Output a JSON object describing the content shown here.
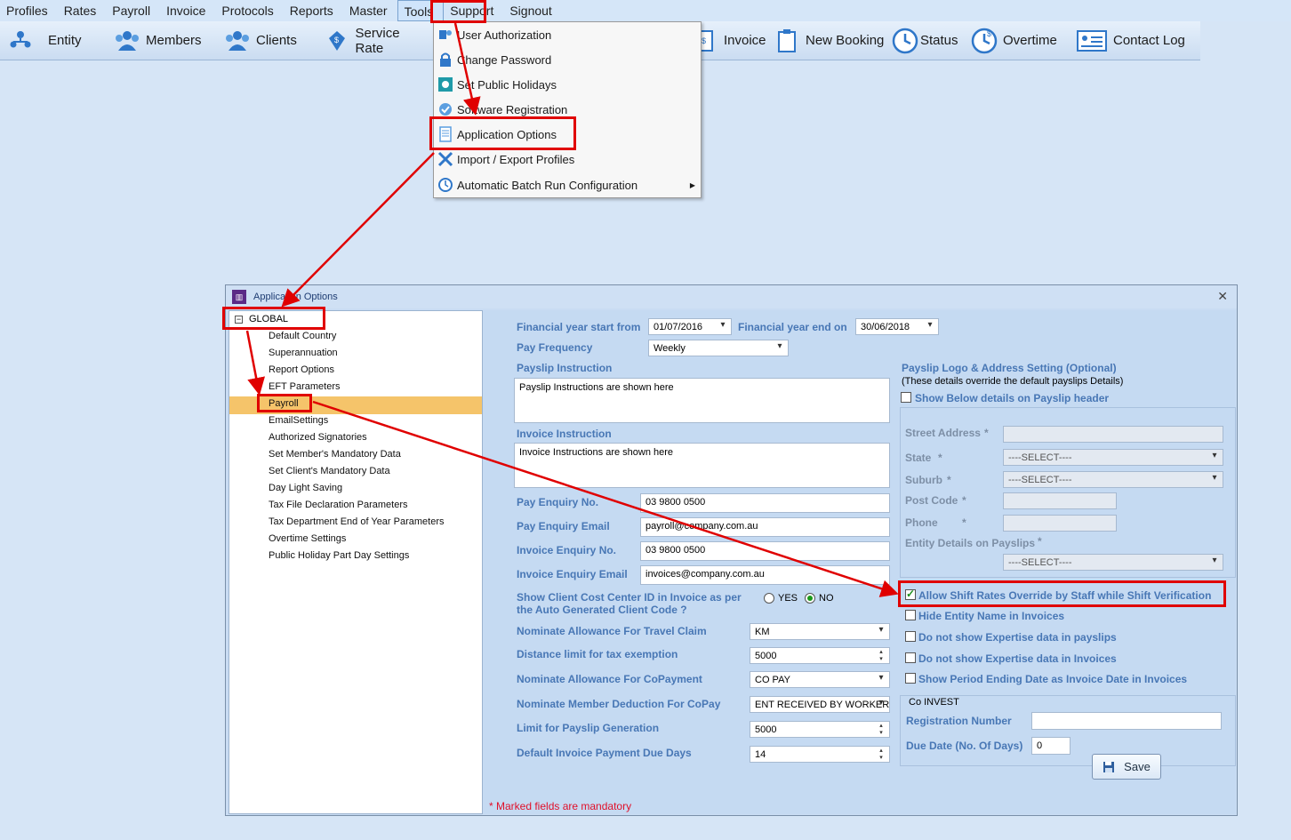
{
  "menubar": {
    "items": [
      "Profiles",
      "Rates",
      "Payroll",
      "Invoice",
      "Protocols",
      "Reports",
      "Master",
      "Tools",
      "Support",
      "Signout"
    ]
  },
  "toolbar": {
    "entity": "Entity",
    "members": "Members",
    "clients": "Clients",
    "service_rates": "Service Rate",
    "invoice": "Invoice",
    "new_booking": "New Booking",
    "status": "Status",
    "overtime": "Overtime",
    "contact_log": "Contact Log"
  },
  "tools_menu": {
    "items": [
      "User Authorization",
      "Change Password",
      "Set Public Holidays",
      "Software Registration",
      "Application Options",
      "Import / Export Profiles",
      "Automatic Batch Run Configuration"
    ]
  },
  "dialog": {
    "title": "Application Options",
    "close": "✕",
    "tree": {
      "root": "GLOBAL",
      "toggle": "−",
      "items": [
        "Default Country",
        "Superannuation",
        "Report Options",
        "EFT Parameters",
        "Payroll",
        "EmailSettings",
        "Authorized Signatories",
        "Set Member's Mandatory Data",
        "Set Client's Mandatory Data",
        "Day Light Saving",
        "Tax File Declaration Parameters",
        "Tax Department End of Year Parameters",
        "Overtime Settings",
        "Public Holiday Part Day Settings"
      ]
    },
    "form": {
      "fy_start_label": "Financial year start from",
      "fy_start_value": "01/07/2016",
      "fy_end_label": "Financial year end on",
      "fy_end_value": "30/06/2018",
      "pay_frequency_label": "Pay Frequency",
      "pay_frequency_value": "Weekly",
      "payslip_instruction_label": "Payslip Instruction",
      "payslip_instruction_value": "Payslip Instructions are shown here",
      "invoice_instruction_label": "Invoice Instruction",
      "invoice_instruction_value": "Invoice Instructions are shown here",
      "pay_enquiry_no_label": "Pay Enquiry No.",
      "pay_enquiry_no_value": "03 9800 0500",
      "pay_enquiry_email_label": "Pay Enquiry Email",
      "pay_enquiry_email_value": "payroll@company.com.au",
      "invoice_enquiry_no_label": "Invoice Enquiry No.",
      "invoice_enquiry_no_value": "03 9800 0500",
      "invoice_enquiry_email_label": "Invoice Enquiry Email",
      "invoice_enquiry_email_value": "invoices@company.com.au",
      "cost_center_label_1": "Show Client Cost Center ID in Invoice as per",
      "cost_center_label_2": "the Auto Generated Client Code ?",
      "yes_label": "YES",
      "no_label": "NO",
      "travel_claim_label": "Nominate Allowance For Travel Claim",
      "travel_claim_value": "KM",
      "distance_limit_label": "Distance limit for tax exemption",
      "distance_limit_value": "5000",
      "copayment_label": "Nominate Allowance For CoPayment",
      "copayment_value": "CO PAY",
      "copay_deduction_label": "Nominate Member Deduction For CoPay",
      "copay_deduction_value": "ENT RECEIVED BY WORKER",
      "payslip_limit_label": "Limit for Payslip Generation",
      "payslip_limit_value": "5000",
      "due_days_label": "Default Invoice Payment Due Days",
      "due_days_value": "14",
      "mandatory_note": "* Marked fields are mandatory"
    },
    "logo": {
      "title": "Payslip Logo & Address Setting (Optional)",
      "subtitle": "(These details override the default payslips Details)",
      "show_below": "Show Below details on Payslip header",
      "street_label": "Street Address",
      "state_label": "State",
      "state_value": "----SELECT----",
      "suburb_label": "Suburb",
      "suburb_value": "----SELECT----",
      "postcode_label": "Post Code",
      "phone_label": "Phone",
      "entity_details_label": "Entity Details on Payslips",
      "entity_details_value": "----SELECT----",
      "star": "*"
    },
    "options": {
      "allow_override": "Allow Shift Rates Override by Staff while Shift Verification",
      "hide_entity": "Hide Entity Name in Invoices",
      "no_expertise_payslips": "Do not show Expertise data in payslips",
      "no_expertise_invoices": "Do not show Expertise data in Invoices",
      "period_ending": "Show Period Ending Date as Invoice Date in Invoices"
    },
    "coinvest": {
      "title": "Co INVEST",
      "reg_label": "Registration Number",
      "reg_value": "",
      "due_label": "Due Date (No. Of Days)",
      "due_value": "0"
    },
    "save": "Save"
  },
  "colors": {
    "highlight": "#e00000",
    "label_blue": "#4877b5",
    "selection": "#f5c46a"
  }
}
